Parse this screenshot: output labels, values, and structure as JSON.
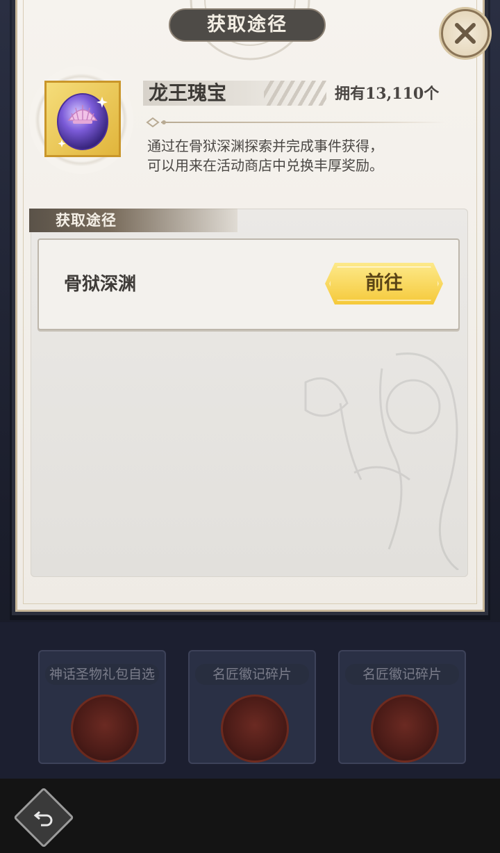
{
  "dialog": {
    "title": "获取途径",
    "close_icon": "close-icon"
  },
  "item": {
    "name": "龙王瑰宝",
    "owned": "拥有13,110个",
    "description_line1": "通过在骨狱深渊探索并完成事件获得，",
    "description_line2": "可以用来在活动商店中兑换丰厚奖励。",
    "icon": "pearl-shell-icon"
  },
  "sources": {
    "section_label": "获取途径",
    "items": [
      {
        "name": "骨狱深渊",
        "button_label": "前往"
      }
    ]
  },
  "background": {
    "cards": [
      {
        "title": "神话圣物礼包自选"
      },
      {
        "title": "名匠徽记碎片"
      },
      {
        "title": "名匠徽记碎片"
      }
    ],
    "back_icon": "back-arrow-icon"
  },
  "colors": {
    "dialog_bg": "#f6f3ee",
    "title_bar": "#4e4b47",
    "gold_button": "#f5c93a",
    "frame_border": "#c9b89a"
  }
}
